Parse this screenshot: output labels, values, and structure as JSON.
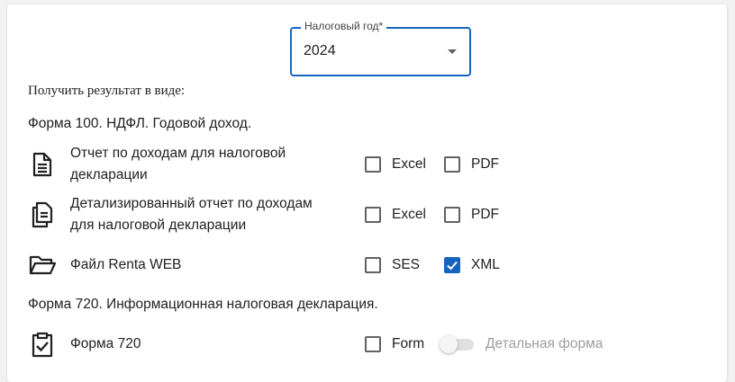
{
  "tax_year": {
    "label": "Налоговый год*",
    "value": "2024"
  },
  "result_label": "Получить результат в виде:",
  "form100": {
    "title": "Форма 100. НДФЛ. Годовой доход.",
    "rows": [
      {
        "icon": "document-icon",
        "label_line1": "Отчет по доходам для налоговой",
        "label_line2": "декларации",
        "options": [
          {
            "label": "Excel",
            "checked": false
          },
          {
            "label": "PDF",
            "checked": false
          }
        ]
      },
      {
        "icon": "documents-copy-icon",
        "label_line1": "Детализированный отчет по доходам",
        "label_line2": "для налоговой декларации",
        "options": [
          {
            "label": "Excel",
            "checked": false
          },
          {
            "label": "PDF",
            "checked": false
          }
        ]
      },
      {
        "icon": "folder-open-icon",
        "label_line1": "Файл Renta WEB",
        "options": [
          {
            "label": "SES",
            "checked": false
          },
          {
            "label": "XML",
            "checked": true
          }
        ]
      }
    ]
  },
  "form720": {
    "title": "Форма 720. Информационная налоговая декларация.",
    "rows": [
      {
        "icon": "clipboard-check-icon",
        "label_line1": "Форма 720",
        "options": [
          {
            "label": "Form",
            "checked": false
          }
        ],
        "toggle": {
          "label": "Детальная форма",
          "on": false,
          "disabled": true
        }
      }
    ]
  },
  "colors": {
    "accent": "#1565c0",
    "disabled_text": "#9e9e9e"
  }
}
